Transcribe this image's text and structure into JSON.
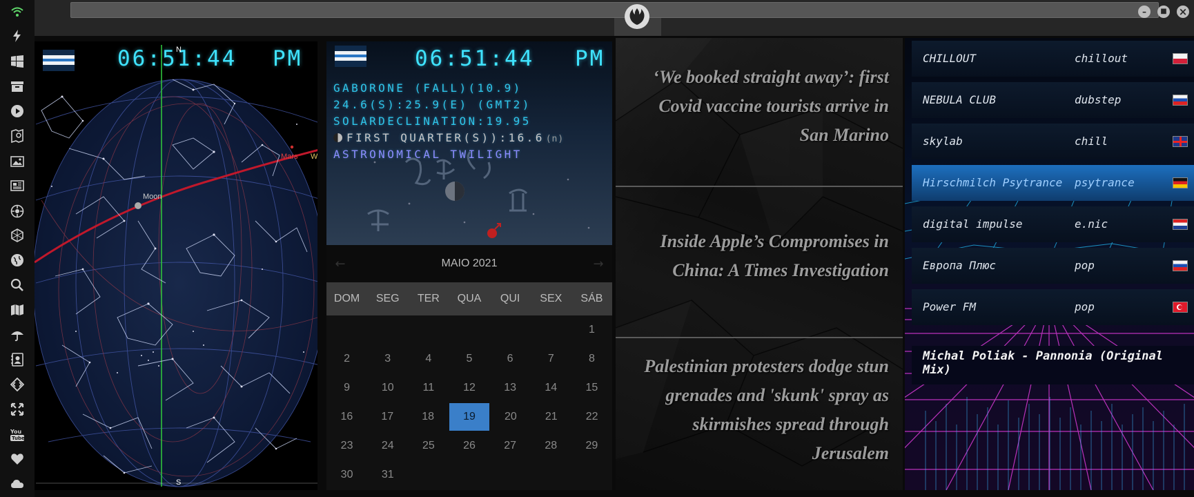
{
  "sidebar": {
    "icons": [
      "wifi-icon",
      "bolt-icon",
      "windows-icon",
      "archive-icon",
      "play-icon",
      "map-book-icon",
      "image-icon",
      "news-icon",
      "settings-icon",
      "hexagon-icon",
      "globe-icon",
      "search-icon",
      "map-icon",
      "umbrella-icon",
      "contact-icon",
      "code-icon",
      "expand-icon",
      "youtube-icon",
      "heart-icon",
      "cloud-icon"
    ]
  },
  "window": {
    "close_symbol": "×",
    "maximize_symbol": "■",
    "minimize_symbol": "–"
  },
  "starmap": {
    "clock_time": "06:51:44",
    "clock_ampm": "PM",
    "north_label": "N",
    "south_label": "S",
    "moon_label": "Moon",
    "mars_label": "Mars",
    "west_label": "W"
  },
  "astro": {
    "clock_time": "06:51:44",
    "clock_ampm": "PM",
    "location_line": "GABORONE (FALL)(10.9)",
    "coords_line": "24.6(S):25.9(E) (GMT2)",
    "declination_line": "SOLARDECLINATION:19.95",
    "moon_phase_line": "FIRST QUARTER(S)):16.6",
    "moon_phase_suffix": "(n)",
    "twilight_line": "ASTRONOMICAL TWILIGHT",
    "colors": {
      "cyan": "#2ec6ea",
      "yellow_accent": "#e8e2b0",
      "violet": "#8c8cff"
    }
  },
  "calendar": {
    "month_label": "MAIO 2021",
    "prev_arrow": "←",
    "next_arrow": "→",
    "weekdays": [
      "DOM",
      "SEG",
      "TER",
      "QUA",
      "QUI",
      "SEX",
      "SÁB"
    ],
    "weeks": [
      [
        "",
        "",
        "",
        "",
        "",
        "",
        "1"
      ],
      [
        "2",
        "3",
        "4",
        "5",
        "6",
        "7",
        "8"
      ],
      [
        "9",
        "10",
        "11",
        "12",
        "13",
        "14",
        "15"
      ],
      [
        "16",
        "17",
        "18",
        "19",
        "20",
        "21",
        "22"
      ],
      [
        "23",
        "24",
        "25",
        "26",
        "27",
        "28",
        "29"
      ],
      [
        "30",
        "31",
        "",
        "",
        "",
        "",
        ""
      ]
    ],
    "today": "19",
    "today_color": "#3a7fc9"
  },
  "news": {
    "headlines": [
      "‘We booked straight away’: first Covid vaccine tourists arrive in San Marino",
      "Inside Apple’s Compromises in China: A Times Investigation",
      "Palestinian protesters dodge stun grenades and 'skunk' spray as skirmishes spread through Jerusalem"
    ]
  },
  "radio": {
    "stations": [
      {
        "name": "CHILLOUT",
        "genre": "chillout",
        "flag": "poland"
      },
      {
        "name": "NEBULA CLUB",
        "genre": "dubstep",
        "flag": "russia"
      },
      {
        "name": "skylab",
        "genre": "chill",
        "flag": "uk"
      },
      {
        "name": "Hirschmilch Psytrance",
        "genre": "psytrance",
        "flag": "germany"
      },
      {
        "name": "digital impulse",
        "genre": "e.nic",
        "flag": "croatia"
      },
      {
        "name": "Европа Плюс",
        "genre": "pop",
        "flag": "russia"
      },
      {
        "name": "Power FM",
        "genre": "pop",
        "flag": "turkey"
      }
    ],
    "active_station": "Hirschmilch Psytrance",
    "now_playing": "Michal Poliak - Pannonia (Original Mix)",
    "accent_color": "#1d6fbf"
  }
}
